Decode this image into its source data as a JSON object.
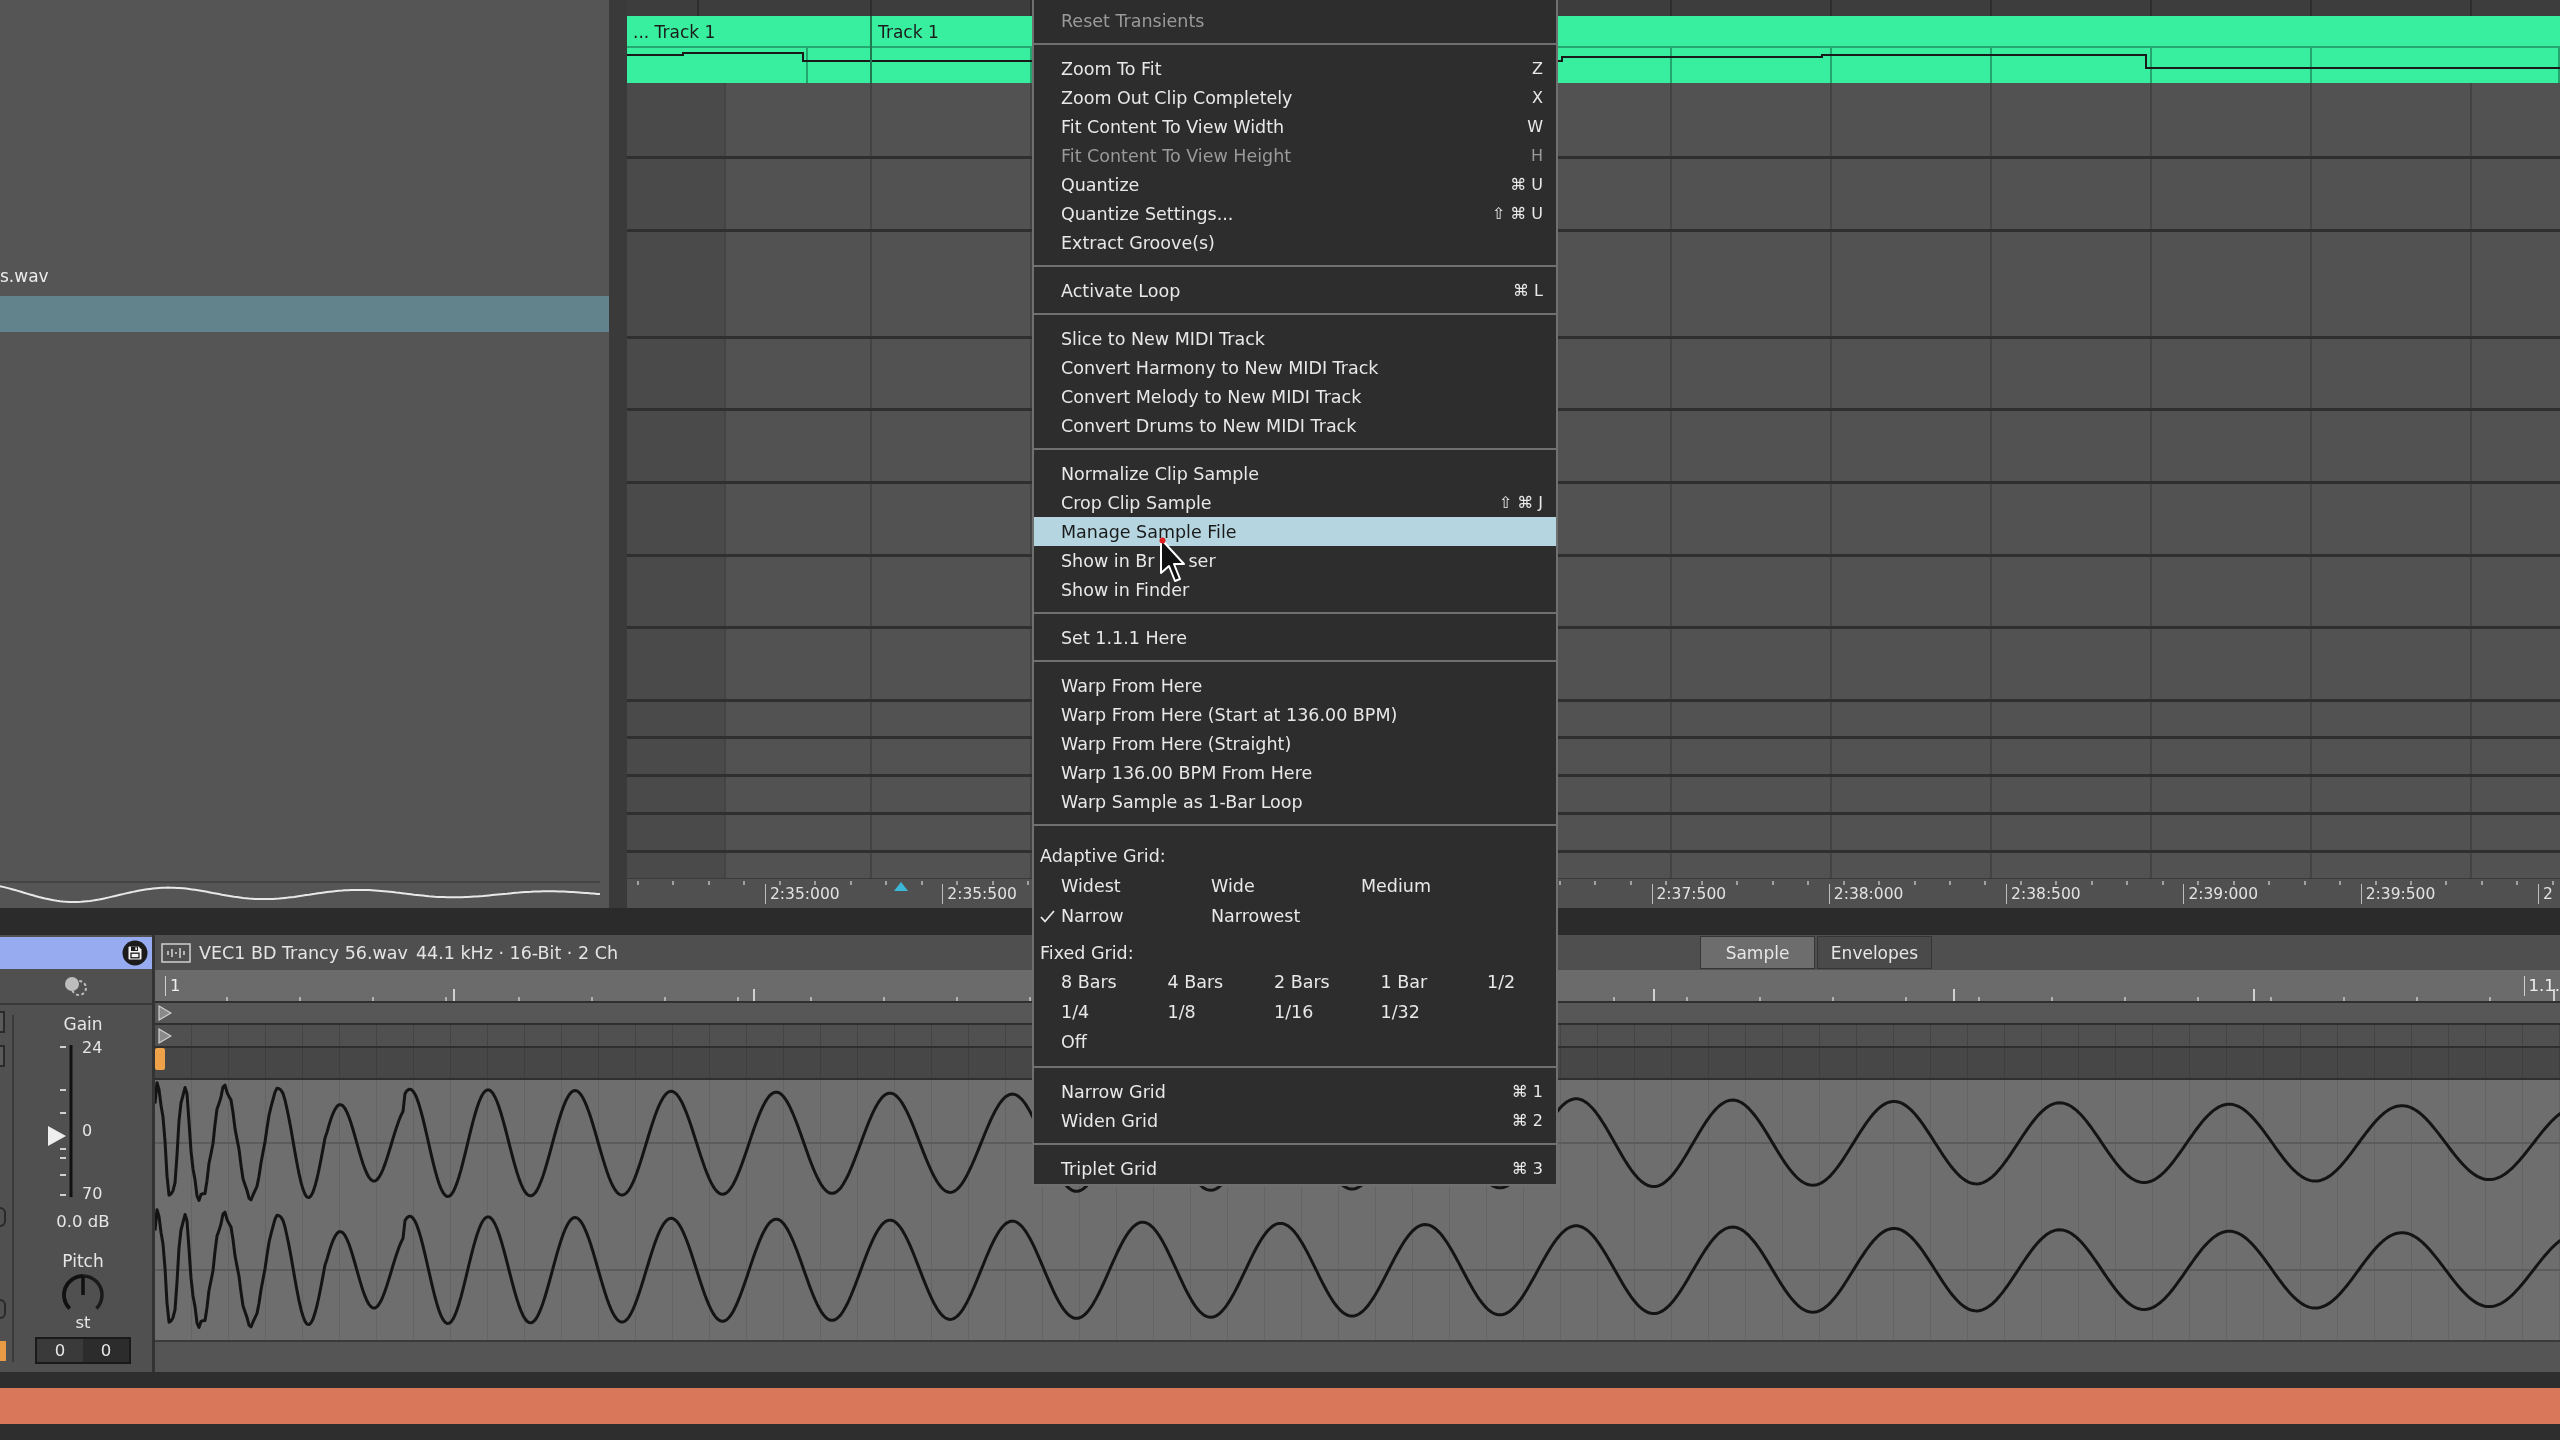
{
  "browser": {
    "items": [
      {
        "label": "s.wav",
        "selected": false
      },
      {
        "selected": true
      }
    ]
  },
  "arrangement": {
    "clips": [
      {
        "name": "... Track 1"
      },
      {
        "name": "Track 1"
      }
    ],
    "ruler_labels": [
      "2:35:000",
      "2:35:500",
      "2:37:500",
      "2:38:000",
      "2:38:500",
      "2:39:000",
      "2:39:500",
      "2"
    ]
  },
  "clip_view": {
    "title": "VEC1 BD Trancy 56.wav",
    "info": "44.1 kHz · 16-Bit · 2 Ch",
    "tabs": [
      {
        "label": "Sample",
        "selected": true
      },
      {
        "label": "Envelopes",
        "selected": false
      }
    ],
    "ruler": {
      "start": "1",
      "end": "1.1."
    },
    "gain": {
      "label": "Gain",
      "scale": [
        "24",
        "0",
        "70"
      ],
      "level": 0.4,
      "reading": "0.0 dB"
    },
    "pitch": {
      "label": "Pitch",
      "level": 0.5,
      "unit": "st",
      "fields": [
        "0",
        "0"
      ]
    }
  },
  "menu": {
    "sections": [
      {
        "kind": "items",
        "items": [
          {
            "label": "Reset Transients",
            "disabled": true,
            "selected": false
          }
        ]
      },
      {
        "kind": "items",
        "items": [
          {
            "label": "Zoom To Fit",
            "shortcut": "Z",
            "disabled": false,
            "selected": false
          },
          {
            "label": "Zoom Out Clip Completely",
            "shortcut": "X",
            "disabled": false,
            "selected": false
          },
          {
            "label": "Fit Content To View Width",
            "shortcut": "W",
            "disabled": false,
            "selected": false
          },
          {
            "label": "Fit Content To View Height",
            "shortcut": "H",
            "disabled": true,
            "selected": false
          },
          {
            "label": "Quantize",
            "shortcut": "⌘ U",
            "disabled": false,
            "selected": false
          },
          {
            "label": "Quantize Settings...",
            "shortcut": "⇧ ⌘ U",
            "disabled": false,
            "selected": false
          },
          {
            "label": "Extract Groove(s)",
            "disabled": false,
            "selected": false
          }
        ]
      },
      {
        "kind": "items",
        "items": [
          {
            "label": "Activate Loop",
            "shortcut": "⌘ L",
            "disabled": false,
            "selected": false
          }
        ]
      },
      {
        "kind": "items",
        "items": [
          {
            "label": "Slice to New MIDI Track",
            "disabled": false,
            "selected": false
          },
          {
            "label": "Convert Harmony to New MIDI Track",
            "disabled": false,
            "selected": false
          },
          {
            "label": "Convert Melody to New MIDI Track",
            "disabled": false,
            "selected": false
          },
          {
            "label": "Convert Drums to New MIDI Track",
            "disabled": false,
            "selected": false
          }
        ]
      },
      {
        "kind": "items",
        "items": [
          {
            "label": "Normalize Clip Sample",
            "disabled": false,
            "selected": false
          },
          {
            "label": "Crop Clip Sample",
            "shortcut": "⇧ ⌘ J",
            "disabled": false,
            "selected": false
          },
          {
            "label": "Manage Sample File",
            "disabled": false,
            "selected": true
          },
          {
            "label_parts": [
              "Show in Br",
              "ser"
            ],
            "disabled": false,
            "selected": false
          },
          {
            "label": "Show in Finder",
            "disabled": false,
            "selected": false
          }
        ]
      },
      {
        "kind": "items",
        "items": [
          {
            "label": "Set 1.1.1 Here",
            "disabled": false,
            "selected": false
          }
        ]
      },
      {
        "kind": "items",
        "items": [
          {
            "label": "Warp From Here",
            "disabled": false,
            "selected": false
          },
          {
            "label": "Warp From Here (Start at 136.00 BPM)",
            "disabled": false,
            "selected": false
          },
          {
            "label": "Warp From Here (Straight)",
            "disabled": false,
            "selected": false
          },
          {
            "label": "Warp 136.00 BPM From Here",
            "disabled": false,
            "selected": false
          },
          {
            "label": "Warp Sample as 1-Bar Loop",
            "disabled": false,
            "selected": false
          }
        ]
      },
      {
        "kind": "grid",
        "groups": [
          {
            "heading": "Adaptive Grid:",
            "rows": [
              {
                "options": [
                  {
                    "label": "Widest",
                    "checked": false
                  },
                  {
                    "label": "Wide",
                    "checked": false
                  },
                  {
                    "label": "Medium",
                    "checked": false
                  }
                ]
              },
              {
                "options": [
                  {
                    "label": "Narrow",
                    "checked": true
                  },
                  {
                    "label": "Narrowest",
                    "checked": false
                  }
                ]
              }
            ]
          },
          {
            "heading": "Fixed Grid:",
            "rows": [
              {
                "options": [
                  {
                    "label": "8 Bars",
                    "checked": false
                  },
                  {
                    "label": "4 Bars",
                    "checked": false
                  },
                  {
                    "label": "2 Bars",
                    "checked": false
                  },
                  {
                    "label": "1 Bar",
                    "checked": false
                  },
                  {
                    "label": "1/2",
                    "checked": false
                  }
                ]
              },
              {
                "options": [
                  {
                    "label": "1/4",
                    "checked": false
                  },
                  {
                    "label": "1/8",
                    "checked": false
                  },
                  {
                    "label": "1/16",
                    "checked": false
                  },
                  {
                    "label": "1/32",
                    "checked": false
                  }
                ]
              },
              {
                "options": [
                  {
                    "label": "Off",
                    "checked": false
                  }
                ]
              }
            ]
          }
        ]
      },
      {
        "kind": "items",
        "items": [
          {
            "label": "Narrow Grid",
            "shortcut": "⌘ 1",
            "disabled": false,
            "selected": false
          },
          {
            "label": "Widen Grid",
            "shortcut": "⌘ 2",
            "disabled": false,
            "selected": false
          }
        ]
      },
      {
        "kind": "items",
        "items": [
          {
            "label": "Triplet Grid",
            "shortcut": "⌘ 3",
            "disabled": false,
            "selected": false
          }
        ]
      }
    ]
  }
}
